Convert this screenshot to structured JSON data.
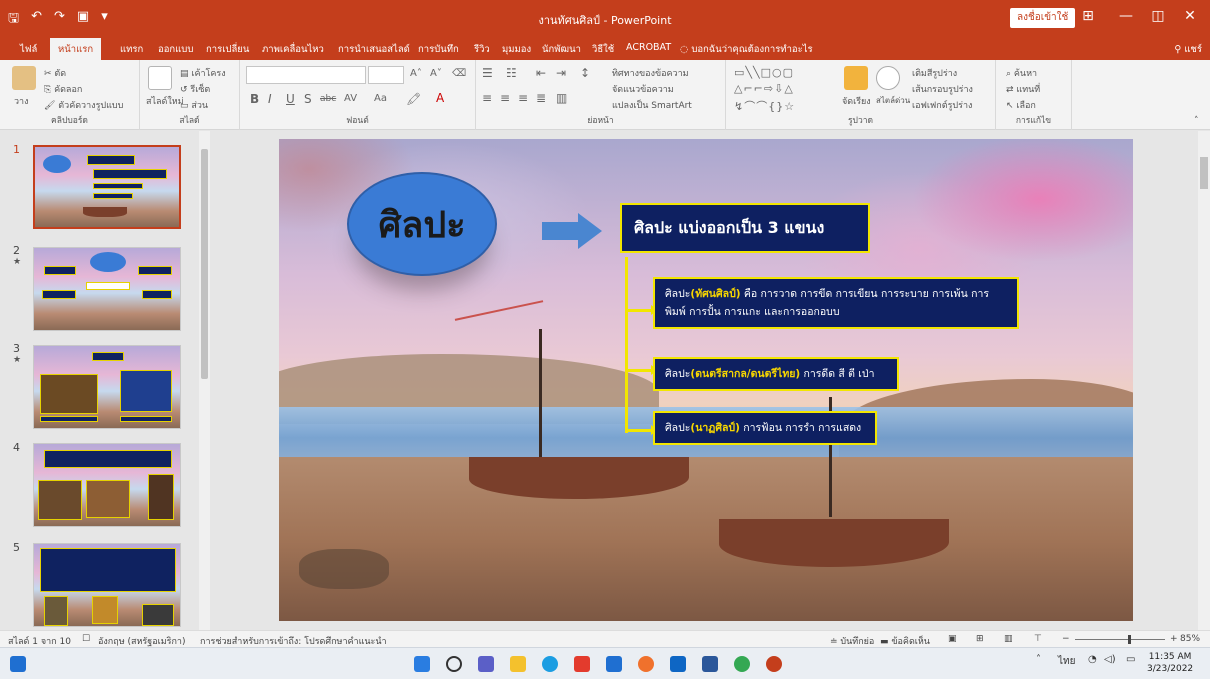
{
  "titlebar": {
    "doc_title": "งานทัศนศิลป์ - PowerPoint",
    "signin_label": "ลงชื่อเข้าใช้",
    "save_icon": "save-icon",
    "undo_icon": "undo-icon",
    "redo_icon": "redo-icon"
  },
  "tabs": [
    {
      "label": "ไฟล์"
    },
    {
      "label": "หน้าแรก"
    },
    {
      "label": "แทรก"
    },
    {
      "label": "ออกแบบ"
    },
    {
      "label": "การเปลี่ยน"
    },
    {
      "label": "ภาพเคลื่อนไหว"
    },
    {
      "label": "การนำเสนอสไลด์"
    },
    {
      "label": "การบันทึก"
    },
    {
      "label": "รีวิว"
    },
    {
      "label": "มุมมอง"
    },
    {
      "label": "นักพัฒนา"
    },
    {
      "label": "วิธีใช้"
    },
    {
      "label": "ACROBAT"
    }
  ],
  "tellme": "บอกฉันว่าคุณต้องการทำอะไร",
  "share_label": "แชร์",
  "ribbon": {
    "clipboard": {
      "paste": "วาง",
      "cut": "ตัด",
      "copy": "คัดลอก",
      "format_painter": "ตัวคัดวางรูปแบบ",
      "label": "คลิปบอร์ด"
    },
    "slides": {
      "new_slide": "สไลด์ใหม่",
      "layout": "เค้าโครง",
      "reset": "รีเซ็ต",
      "section": "ส่วน",
      "label": "สไลด์"
    },
    "font": {
      "label": "ฟอนต์",
      "bold": "B",
      "italic": "I",
      "underline": "U",
      "shadow": "S",
      "strike": "abc",
      "spacing": "AV",
      "case": "Aa"
    },
    "paragraph": {
      "label": "ย่อหน้า",
      "text_direction": "ทิศทางของข้อความ",
      "align_text": "จัดแนวข้อความ",
      "smartart": "แปลงเป็น SmartArt"
    },
    "drawing": {
      "label": "รูปวาด",
      "arrange": "จัดเรียง",
      "quick_styles": "สไตล์ด่วน",
      "fill": "เติมสีรูปร่าง",
      "outline": "เส้นกรอบรูปร่าง",
      "effects": "เอฟเฟกต์รูปร่าง"
    },
    "editing": {
      "label": "การแก้ไข",
      "find": "ค้นหา",
      "replace": "แทนที่",
      "select": "เลือก"
    }
  },
  "thumbnails": [
    {
      "num": "1",
      "star": ""
    },
    {
      "num": "2",
      "star": "★"
    },
    {
      "num": "3",
      "star": "★"
    },
    {
      "num": "4",
      "star": ""
    },
    {
      "num": "5",
      "star": ""
    }
  ],
  "slide": {
    "title": "ศิลปะ",
    "heading": "ศิลปะ แบ่งออกเป็น 3 แขนง",
    "items": [
      {
        "prefix": "ศิลปะ",
        "highlight": "(ทัศนศิลป์)",
        "text": " คือ การวาด การขีด การเขียน การระบาย การเพ้น การพิมพ์ การปั้น การแกะ และการออกอบบ"
      },
      {
        "prefix": "ศิลปะ",
        "highlight": "(ดนตรีสากล/ดนตรีไทย)",
        "text": " การดีด สี ตี เป่า"
      },
      {
        "prefix": "ศิลปะ",
        "highlight": "(นาฏศิลป์)",
        "text": " การฟ้อน การรำ การแสดง"
      }
    ]
  },
  "status": {
    "slide_count": "สไลด์ 1 จาก 10",
    "language": "อังกฤษ (สหรัฐอเมริกา)",
    "accessibility": "การช่วยสำหรับการเข้าถึง: โปรดศึกษาคำแนะนำ",
    "notes": "บันทึกย่อ",
    "comments": "ข้อคิดเห็น",
    "zoom": "85%"
  },
  "taskbar": {
    "lang": "ไทย",
    "time": "11:35 AM",
    "date": "3/23/2022"
  },
  "colors": {
    "accent": "#c43e1c",
    "box_fill": "#0e2061",
    "box_border": "#f2e600",
    "highlight": "#f7d600",
    "ellipse": "#3a7bd5"
  }
}
